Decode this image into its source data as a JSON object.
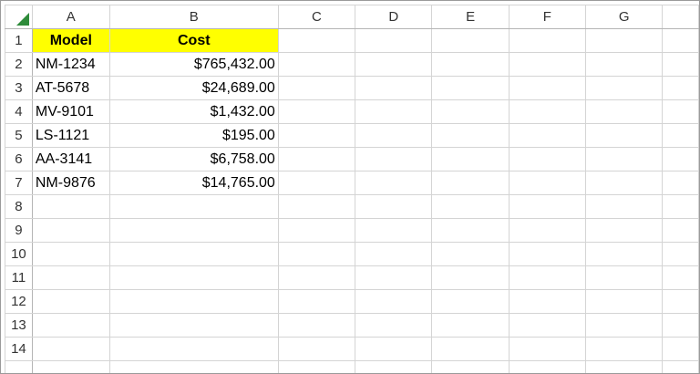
{
  "columns": [
    "A",
    "B",
    "C",
    "D",
    "E",
    "F",
    "G",
    ""
  ],
  "rows": [
    "1",
    "2",
    "3",
    "4",
    "5",
    "6",
    "7",
    "8",
    "9",
    "10",
    "11",
    "12",
    "13",
    "14"
  ],
  "header": {
    "a": "Model",
    "b": "Cost"
  },
  "data": [
    {
      "model": "NM-1234",
      "cost": "$765,432.00"
    },
    {
      "model": "AT-5678",
      "cost": "$24,689.00"
    },
    {
      "model": "MV-9101",
      "cost": "$1,432.00"
    },
    {
      "model": "LS-1121",
      "cost": "$195.00"
    },
    {
      "model": "AA-3141",
      "cost": "$6,758.00"
    },
    {
      "model": "NM-9876",
      "cost": "$14,765.00"
    }
  ],
  "colors": {
    "header_fill": "#ffff00",
    "select_all": "#2e8b3a",
    "gridline": "#d4d4d4"
  },
  "icons": {
    "select_all": "select-all-triangle-icon"
  }
}
